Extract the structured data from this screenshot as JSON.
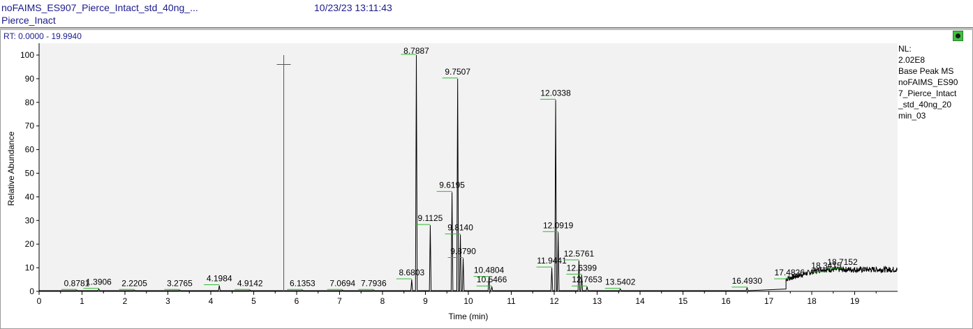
{
  "header": {
    "file": "noFAIMS_ES907_Pierce_Intact_std_40ng_...",
    "datetime": "10/23/23 13:11:43",
    "process": "Pierce_Inact"
  },
  "rt_range": "RT: 0.0000 - 19.9940",
  "side_info": {
    "nl_label": "NL:",
    "nl_value": "2.02E8",
    "trace": "Base Peak  MS",
    "file_lines": [
      "noFAIMS_ES90",
      "7_Pierce_Intact",
      "_std_40ng_20",
      "min_03"
    ]
  },
  "colors": {
    "trace": "#000000",
    "label_tick": "#2db82d",
    "plot_bg": "#f2f2f2",
    "header_text": "#1a1a8c"
  },
  "icons": {
    "pin": "pin-icon"
  },
  "chart_data": {
    "type": "line",
    "xlabel": "Time (min)",
    "ylabel": "Relative Abundance",
    "xlim": [
      0,
      20
    ],
    "ylim": [
      0,
      100
    ],
    "xticks": [
      0,
      1,
      2,
      3,
      4,
      5,
      6,
      7,
      8,
      9,
      10,
      11,
      12,
      13,
      14,
      15,
      16,
      17,
      18,
      19
    ],
    "yticks": [
      0,
      10,
      20,
      30,
      40,
      50,
      60,
      70,
      80,
      90,
      100
    ],
    "peaks": [
      {
        "label": "0.8781",
        "x": 0.8781,
        "y": 0.5
      },
      {
        "label": "1.3906",
        "x": 1.3906,
        "y": 1
      },
      {
        "label": "2.2205",
        "x": 2.2205,
        "y": 0.5
      },
      {
        "label": "3.2765",
        "x": 3.2765,
        "y": 0.5
      },
      {
        "label": "4.1984",
        "x": 4.1984,
        "y": 2.5
      },
      {
        "label": "4.9142",
        "x": 4.9142,
        "y": 0.5
      },
      {
        "label": "6.1353",
        "x": 6.1353,
        "y": 0.5
      },
      {
        "label": "7.0694",
        "x": 7.0694,
        "y": 0.5
      },
      {
        "label": "7.7936",
        "x": 7.7936,
        "y": 0.5
      },
      {
        "label": "8.6803",
        "x": 8.6803,
        "y": 5
      },
      {
        "label": "8.7887",
        "x": 8.7887,
        "y": 100
      },
      {
        "label": "9.1125",
        "x": 9.1125,
        "y": 28
      },
      {
        "label": "9.6195",
        "x": 9.6195,
        "y": 42
      },
      {
        "label": "9.7507",
        "x": 9.7507,
        "y": 90
      },
      {
        "label": "9.8140",
        "x": 9.814,
        "y": 24
      },
      {
        "label": "9.8790",
        "x": 9.879,
        "y": 14
      },
      {
        "label": "10.4804",
        "x": 10.4804,
        "y": 6
      },
      {
        "label": "10.5466",
        "x": 10.5466,
        "y": 2
      },
      {
        "label": "11.9441",
        "x": 11.9441,
        "y": 10
      },
      {
        "label": "12.0338",
        "x": 12.0338,
        "y": 81
      },
      {
        "label": "12.0919",
        "x": 12.0919,
        "y": 25
      },
      {
        "label": "12.5761",
        "x": 12.5761,
        "y": 13
      },
      {
        "label": "12.6399",
        "x": 12.6399,
        "y": 7
      },
      {
        "label": "12.7653",
        "x": 12.7653,
        "y": 2
      },
      {
        "label": "13.5402",
        "x": 13.5402,
        "y": 1
      },
      {
        "label": "16.4930",
        "x": 16.493,
        "y": 1.5
      },
      {
        "label": "17.4826",
        "x": 17.4826,
        "y": 5
      },
      {
        "label": "18.3415",
        "x": 18.3415,
        "y": 8
      },
      {
        "label": "18.7152",
        "x": 18.7152,
        "y": 9.5
      }
    ],
    "marker_x": 5.7,
    "marker_y": 96
  }
}
